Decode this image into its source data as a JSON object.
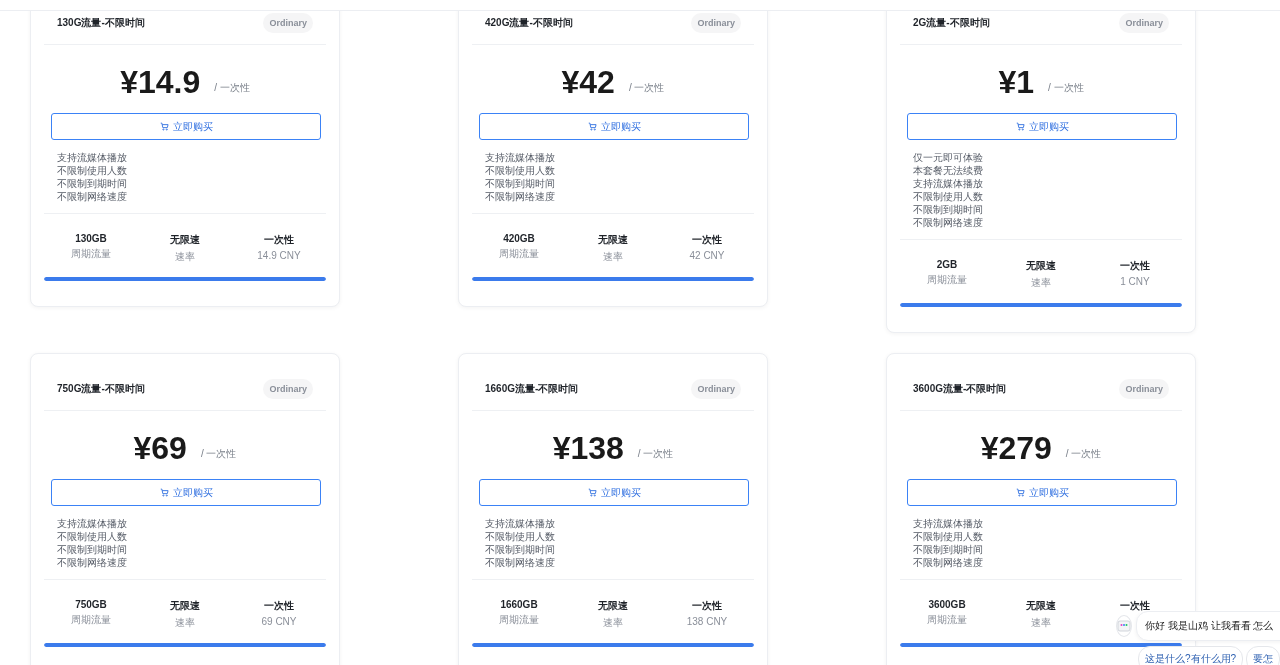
{
  "plans": [
    {
      "title": "130G流量-不限时间",
      "badge": "Ordinary",
      "price": "¥14.9",
      "period": "/ 一次性",
      "buy": "立即购买",
      "features": [
        "支持流媒体播放",
        "不限制使用人数",
        "不限制到期时间",
        "不限制网络速度"
      ],
      "stats": [
        {
          "value": "130GB",
          "label": "周期流量"
        },
        {
          "value": "无限速",
          "label": "速率"
        },
        {
          "value": "一次性",
          "label": "14.9 CNY"
        }
      ],
      "level": 1
    },
    {
      "title": "420G流量-不限时间",
      "badge": "Ordinary",
      "price": "¥42",
      "period": "/ 一次性",
      "buy": "立即购买",
      "features": [
        "支持流媒体播放",
        "不限制使用人数",
        "不限制到期时间",
        "不限制网络速度"
      ],
      "stats": [
        {
          "value": "420GB",
          "label": "周期流量"
        },
        {
          "value": "无限速",
          "label": "速率"
        },
        {
          "value": "一次性",
          "label": "42 CNY"
        }
      ],
      "level": 1
    },
    {
      "title": "2G流量-不限时间",
      "badge": "Ordinary",
      "price": "¥1",
      "period": "/ 一次性",
      "buy": "立即购买",
      "features": [
        "仅一元即可体验",
        "本套餐无法续费",
        "支持流媒体播放",
        "不限制使用人数",
        "不限制到期时间",
        "不限制网络速度"
      ],
      "stats": [
        {
          "value": "2GB",
          "label": "周期流量"
        },
        {
          "value": "无限速",
          "label": "速率"
        },
        {
          "value": "一次性",
          "label": "1 CNY"
        }
      ],
      "level": 1
    },
    {
      "title": "750G流量-不限时间",
      "badge": "Ordinary",
      "price": "¥69",
      "period": "/ 一次性",
      "buy": "立即购买",
      "features": [
        "支持流媒体播放",
        "不限制使用人数",
        "不限制到期时间",
        "不限制网络速度"
      ],
      "stats": [
        {
          "value": "750GB",
          "label": "周期流量"
        },
        {
          "value": "无限速",
          "label": "速率"
        },
        {
          "value": "一次性",
          "label": "69 CNY"
        }
      ],
      "level": 1
    },
    {
      "title": "1660G流量-不限时间",
      "badge": "Ordinary",
      "price": "¥138",
      "period": "/ 一次性",
      "buy": "立即购买",
      "features": [
        "支持流媒体播放",
        "不限制使用人数",
        "不限制到期时间",
        "不限制网络速度"
      ],
      "stats": [
        {
          "value": "1660GB",
          "label": "周期流量"
        },
        {
          "value": "无限速",
          "label": "速率"
        },
        {
          "value": "一次性",
          "label": "138 CNY"
        }
      ],
      "level": 1
    },
    {
      "title": "3600G流量-不限时间",
      "badge": "Ordinary",
      "price": "¥279",
      "period": "/ 一次性",
      "buy": "立即购买",
      "features": [
        "支持流媒体播放",
        "不限制使用人数",
        "不限制到期时间",
        "不限制网络速度"
      ],
      "stats": [
        {
          "value": "3600GB",
          "label": "周期流量"
        },
        {
          "value": "无限速",
          "label": "速率"
        },
        {
          "value": "一次性"
        }
      ],
      "level": 1
    }
  ],
  "chat": {
    "greeting": "你好 我是山鸡 让我看看 怎么",
    "suggestions": [
      "这是什么?有什么用?",
      "要怎"
    ]
  }
}
